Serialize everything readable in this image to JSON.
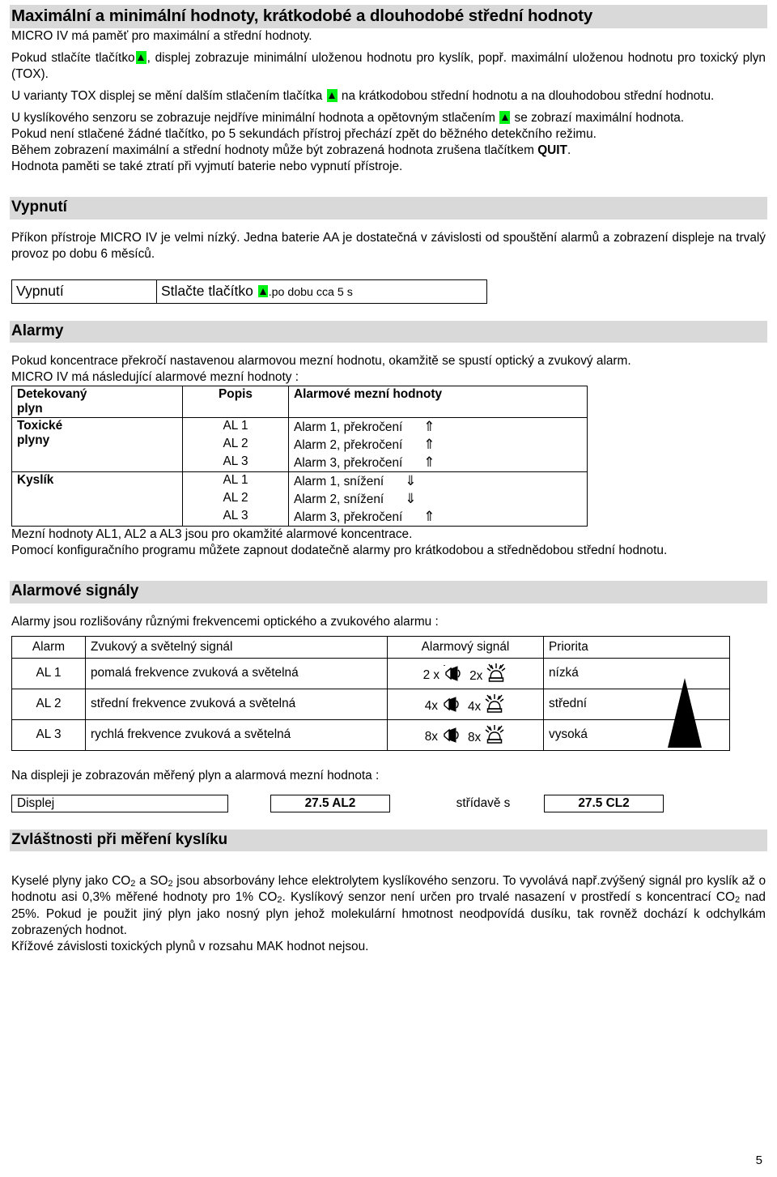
{
  "document": {
    "page_number": "5",
    "heading_background": "#d9d9d9",
    "key_icon_color": "#00f215"
  },
  "section_max_min": {
    "heading": "Maximální a minimální hodnoty, krátkodobé a dlouhodobé střední hodnoty",
    "p1": "MICRO IV má paměť pro maximální a střední hodnoty.",
    "p2_a": "Pokud stlačíte tlačítko",
    "p2_b": ", displej zobrazuje minimální uloženou hodnotu pro kyslík, popř. maximální uloženou hodnotu pro toxický plyn (TOX).",
    "p3_a": "U varianty TOX displej se mění dalším stlačením tlačítka",
    "p3_b": "na krátkodobou střední hodnotu a na dlouhodobou střední hodnotu.",
    "p4_a": "U kyslíkového senzoru se zobrazuje nejdříve minimální hodnota a opětovným stlačením",
    "p4_b": "se zobrazí maximální hodnota.",
    "p5": "Pokud není stlačené žádné tlačítko, po 5 sekundách přístroj přechází zpět do běžného detekčního režimu.",
    "p6_a": "Během zobrazení maximální a střední hodnoty může být zobrazená hodnota zrušena tlačítkem ",
    "p6_bold": "QUIT",
    "p6_b": ".",
    "p7": "Hodnota paměti se také ztratí při vyjmutí baterie nebo vypnutí přístroje."
  },
  "section_vypnuti": {
    "heading": "Vypnutí",
    "p1": "Příkon přístroje MICRO IV je velmi nízký. Jedna baterie AA je dostatečná v závislosti od spouštění alarmů a zobrazení displeje na trvalý provoz po dobu 6 měsíců.",
    "table": {
      "label": "Vypnutí",
      "action_a": "Stlačte tlačítko",
      "action_b": ".po dobu cca 5 s"
    }
  },
  "section_alarmy": {
    "heading": "Alarmy",
    "p1": "Pokud koncentrace překročí nastavenou alarmovou mezní hodnotu, okamžitě se spustí optický a zvukový alarm.",
    "p2": "MICRO IV má následující alarmové mezní hodnoty :",
    "table": {
      "headers": [
        "Detekovaný plyn",
        "Popis",
        "Alarmové mezní hodnoty"
      ],
      "header_gas_line1": "Detekovaný",
      "header_gas_line2": "plyn",
      "groups": [
        {
          "gas_line1": "Toxické",
          "gas_line2": "plyny",
          "rows": [
            {
              "desc": "AL 1",
              "limit": "Alarm 1,  překročení",
              "arrow": "⇑"
            },
            {
              "desc": "AL 2",
              "limit": "Alarm 2,  překročení",
              "arrow": "⇑"
            },
            {
              "desc": "AL 3",
              "limit": "Alarm 3,  překročení",
              "arrow": "⇑"
            }
          ]
        },
        {
          "gas_line1": "Kyslík",
          "gas_line2": "",
          "rows": [
            {
              "desc": "AL 1",
              "limit": "Alarm 1,  snížení",
              "arrow": "⇓"
            },
            {
              "desc": "AL 2",
              "limit": "Alarm 2,  snížení",
              "arrow": "⇓"
            },
            {
              "desc": "AL 3",
              "limit": "Alarm 3,  překročení",
              "arrow": "⇑"
            }
          ]
        }
      ]
    },
    "p3": "Mezní hodnoty AL1, AL2 a AL3 jsou pro okamžité alarmové koncentrace.",
    "p4": "Pomocí konfiguračního programu můžete zapnout dodatečně alarmy pro krátkodobou a střednědobou střední hodnotu."
  },
  "section_signaly": {
    "heading": "Alarmové signály",
    "p1": "Alarmy jsou rozlišovány různými frekvencemi optického a zvukového alarmu :",
    "table": {
      "headers": [
        "Alarm",
        "Zvukový a světelný signál",
        "Alarmový signál",
        "Priorita"
      ],
      "rows": [
        {
          "alarm": "AL 1",
          "sound": "pomalá frekvence zvuková a světelná",
          "horn_count": "2 x",
          "beacon_count": "2x",
          "priority": "nízká"
        },
        {
          "alarm": "AL 2",
          "sound": "střední frekvence zvuková a světelná",
          "horn_count": "4x",
          "beacon_count": "4x",
          "priority": "střední"
        },
        {
          "alarm": "AL 3",
          "sound": "rychlá frekvence zvuková a světelná",
          "horn_count": "8x",
          "beacon_count": "8x",
          "priority": "vysoká"
        }
      ]
    },
    "p2": "Na displeji je zobrazován měřený plyn a alarmová mezní hodnota :",
    "display_row": {
      "label": "Displej",
      "value_1": "27.5  AL2",
      "between": "střídavě s",
      "value_2": "27.5 CL2"
    }
  },
  "section_kyslik": {
    "heading": "Zvláštnosti při měření kyslíku",
    "p1_part1": "Kyselé plyny jako CO",
    "p1_sub1": "2",
    "p1_part2": " a SO",
    "p1_sub2": "2",
    "p1_part3": " jsou absorbovány lehce elektrolytem kyslíkového senzoru. To vyvolává např.zvýšený signál pro kyslík  až o hodnotu asi 0,3%  měřené hodnoty pro 1% CO",
    "p1_sub3": "2",
    "p1_part4": ". Kyslíkový senzor není určen pro trvalé nasazení v prostředí s koncentrací CO",
    "p1_sub4": "2",
    "p1_part5": " nad 25%. Pokud je použit jiný plyn jako nosný plyn jehož molekulární hmotnost neodpovídá dusíku, tak rovněž dochází k odchylkám zobrazených hodnot.",
    "p2": "Křížové závislosti toxických plynů v rozsahu MAK hodnot nejsou."
  }
}
